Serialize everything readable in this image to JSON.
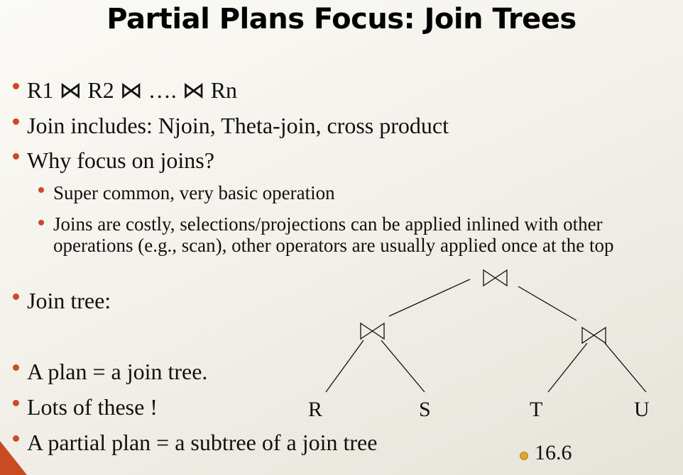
{
  "title": "Partial Plans Focus: Join Trees",
  "bullets": {
    "b1": "R1 ⋈ R2 ⋈ …. ⋈ Rn",
    "b2": "Join includes: Njoin, Theta-join, cross product",
    "b3": "Why focus on joins?",
    "b3a": "Super common, very basic operation",
    "b3b": "Joins are costly, selections/projections can be applied inlined with other operations (e.g., scan), other operators are usually applied once at the top",
    "b4": "Join tree:",
    "b5": "A plan = a join tree.",
    "b6": "Lots of these !",
    "b7": "A partial plan = a subtree of a join tree"
  },
  "tree": {
    "join_symbol": "⋈",
    "leaves": [
      "R",
      "S",
      "T",
      "U"
    ]
  },
  "reference": "16.6",
  "colors": {
    "bullet": "#c94b23",
    "reference_icon": "#e0a82a"
  }
}
